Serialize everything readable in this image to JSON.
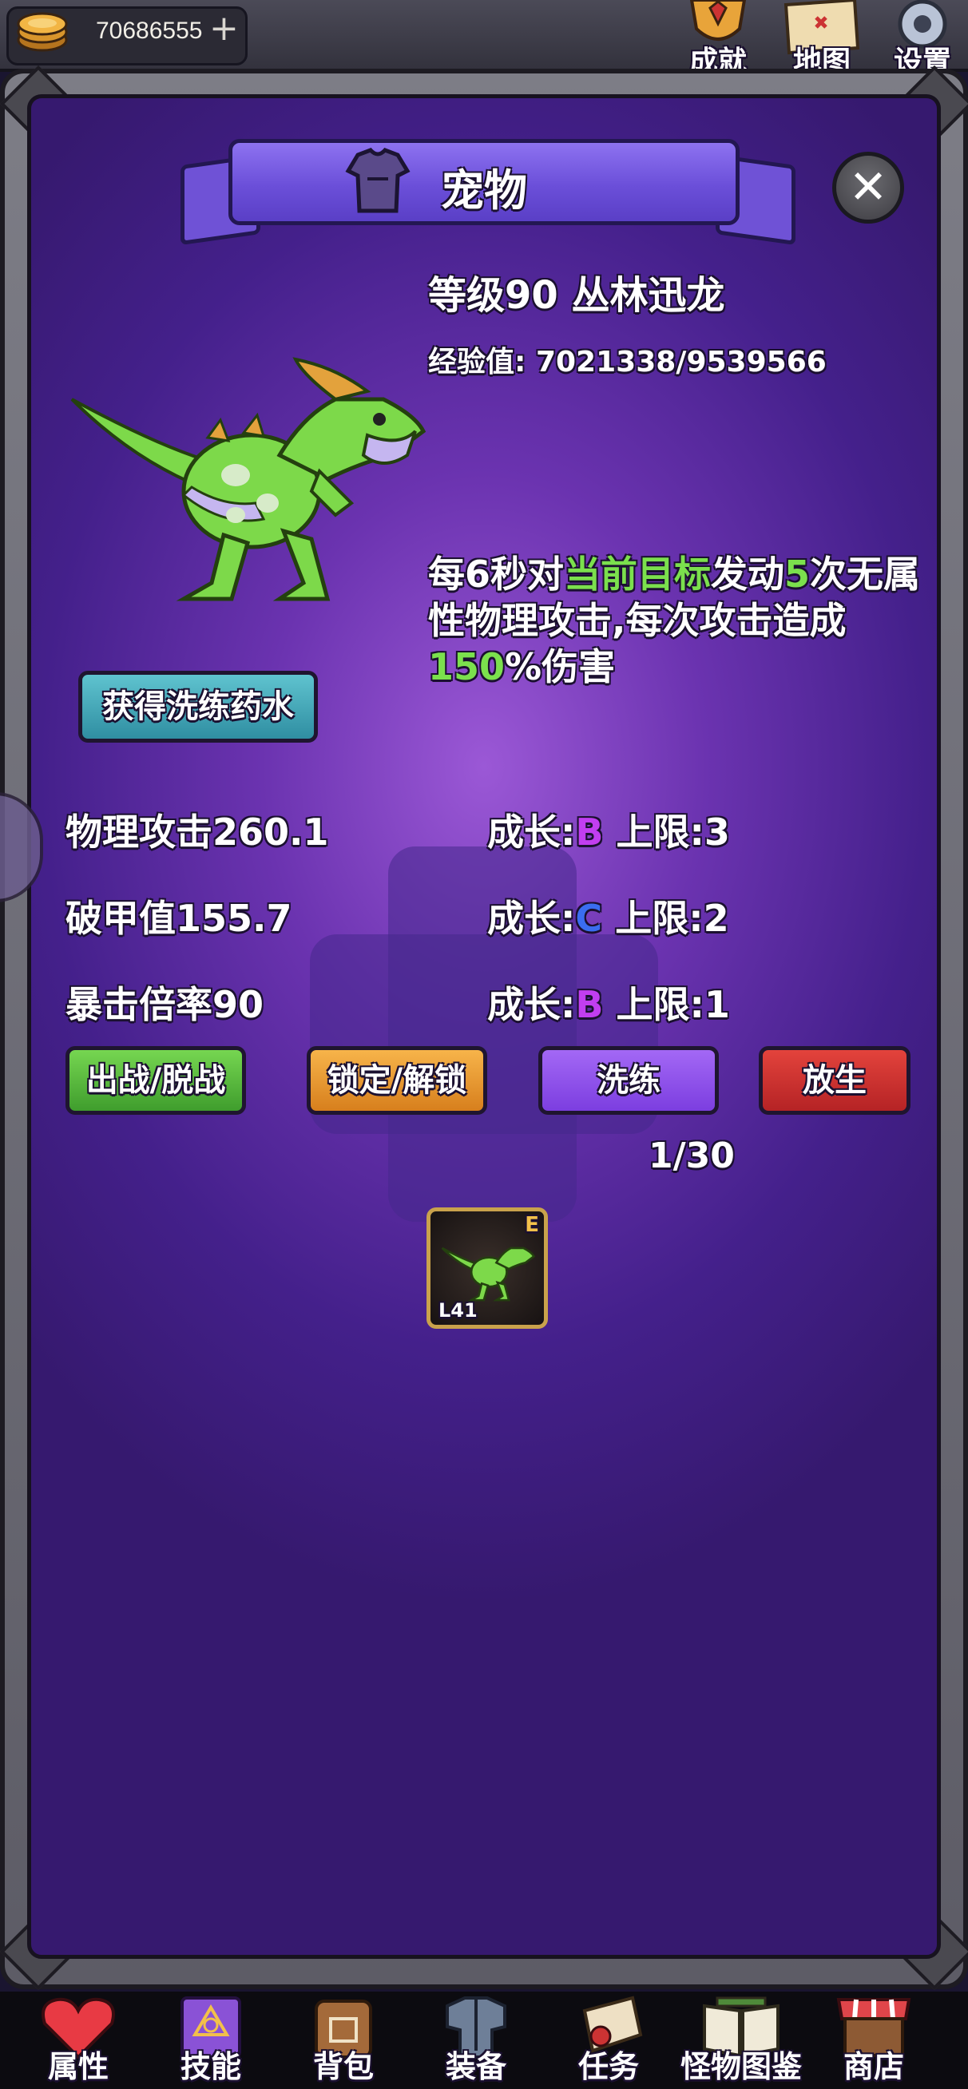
{
  "currency": {
    "gold": "70686555",
    "add_symbol": "+"
  },
  "top_icons": [
    {
      "name": "achievements",
      "label": "成就"
    },
    {
      "name": "map",
      "label": "地图"
    },
    {
      "name": "settings",
      "label": "设置"
    }
  ],
  "panel": {
    "title": "宠物",
    "close_symbol": "✕"
  },
  "pet": {
    "level_name": "等级90 丛林迅龙",
    "exp_label": "经验值:",
    "exp_value": "7021338/9539566",
    "skill": {
      "p1": "每6秒对",
      "p2": "当前目标",
      "p3": "发动",
      "p4": "5",
      "p5": "次无属性物理攻击,每次攻击造成",
      "p6": "150",
      "p7": "%伤害"
    },
    "get_potion_label": "获得洗练药水",
    "stats": [
      {
        "label": "物理攻击260.1",
        "growth_prefix": "成长:",
        "grade": "B",
        "limit": "上限:3"
      },
      {
        "label": "破甲值155.7",
        "growth_prefix": "成长:",
        "grade": "C",
        "limit": "上限:2"
      },
      {
        "label": "暴击倍率90",
        "growth_prefix": "成长:",
        "grade": "B",
        "limit": "上限:1"
      }
    ],
    "actions": {
      "deploy": "出战/脱战",
      "lock": "锁定/解锁",
      "refine": "洗练",
      "release": "放生"
    },
    "count": "1/30",
    "slot": {
      "grade": "E",
      "level": "L41"
    }
  },
  "colors": {
    "highlight": "#7be04d",
    "grade_B": "#c13ef0",
    "grade_C": "#3a6df0"
  },
  "bottom_nav": [
    {
      "name": "attributes",
      "label": "属性"
    },
    {
      "name": "skills",
      "label": "技能"
    },
    {
      "name": "bag",
      "label": "背包"
    },
    {
      "name": "equipment",
      "label": "装备"
    },
    {
      "name": "quests",
      "label": "任务"
    },
    {
      "name": "bestiary",
      "label": "怪物图鉴"
    },
    {
      "name": "shop",
      "label": "商店"
    }
  ]
}
